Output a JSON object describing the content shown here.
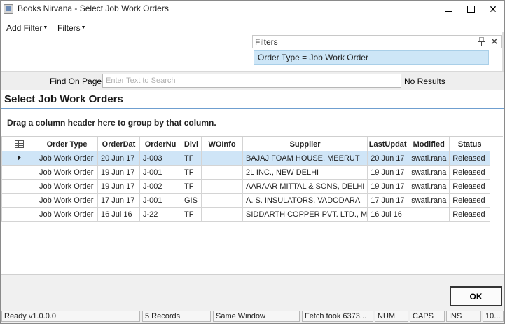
{
  "window": {
    "title": "Books Nirvana - Select Job Work Orders",
    "min_icon": "minimize-icon",
    "max_icon": "maximize-icon",
    "close_glyph": "✕"
  },
  "menu": {
    "add_filter": "Add Filter",
    "filters": "Filters",
    "caret": "▼"
  },
  "filters_panel": {
    "title": "Filters",
    "pin_glyph": "📌",
    "close_glyph": "✕",
    "active_filter": "Order Type = Job Work Order"
  },
  "find": {
    "label": "Find On Page",
    "placeholder": "Enter Text to Search",
    "result": "No Results"
  },
  "section": {
    "title": "Select Job Work Orders",
    "group_hint": "Drag a column header here to group by that column."
  },
  "grid": {
    "columns": [
      "Order Type",
      "OrderDat",
      "OrderNu",
      "Divi",
      "WOInfo",
      "Supplier",
      "LastUpdat",
      "Modified",
      "Status"
    ],
    "rows": [
      [
        "Job Work Order",
        "20 Jun 17",
        "J-003",
        "TF",
        "",
        "BAJAJ FOAM HOUSE, MEERUT",
        "20 Jun 17",
        "swati.rana",
        "Released"
      ],
      [
        "Job Work Order",
        "19 Jun 17",
        "J-001",
        "TF",
        "",
        "2L INC., NEW DELHI",
        "19 Jun 17",
        "swati.rana",
        "Released"
      ],
      [
        "Job Work Order",
        "19 Jun 17",
        "J-002",
        "TF",
        "",
        "AARAAR MITTAL & SONS, DELHI",
        "19 Jun 17",
        "swati.rana",
        "Released"
      ],
      [
        "Job Work Order",
        "17 Jun 17",
        "J-001",
        "GIS",
        "",
        "A. S. INSULATORS, VADODARA",
        "17 Jun 17",
        "swati.rana",
        "Released"
      ],
      [
        "Job Work Order",
        "16 Jul 16",
        "J-22",
        "TF",
        "",
        "SIDDARTH COPPER PVT. LTD., M",
        "16 Jul 16",
        "",
        "Released"
      ]
    ],
    "selected_row": 0
  },
  "actions": {
    "ok_label": "OK"
  },
  "status": {
    "ready": "Ready v1.0.0.0",
    "records": "5 Records",
    "window_mode": "Same Window",
    "fetch": "Fetch took 6373...",
    "num": "NUM",
    "caps": "CAPS",
    "ins": "INS",
    "extra": "10..."
  }
}
